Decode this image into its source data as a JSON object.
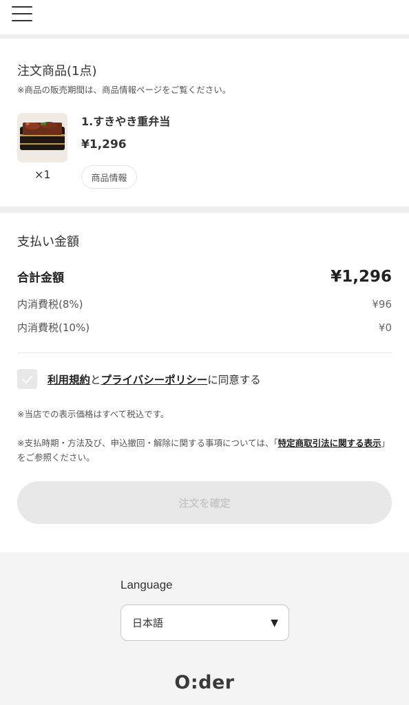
{
  "header": {
    "menu_icon": "hamburger-menu-icon"
  },
  "order": {
    "title": "注文商品(1点)",
    "note": "※商品の販売期間は、商品情報ページをご覧ください。",
    "item": {
      "name": "1.すきやき重弁当",
      "price": "¥1,296",
      "quantity": "×1",
      "info_button": "商品情報"
    }
  },
  "payment": {
    "title": "支払い金額",
    "total_label": "合計金額",
    "total_value": "¥1,296",
    "tax8_label": "内消費税(8%)",
    "tax8_value": "¥96",
    "tax10_label": "内消費税(10%)",
    "tax10_value": "¥0",
    "agree": {
      "terms_link": "利用規約",
      "and": "と",
      "privacy_link": "プライバシーポリシー",
      "suffix": "に同意する",
      "checked": false
    },
    "note_tax_included": "※当店での表示価格はすべて税込です。",
    "note_law_prefix": "※支払時期・方法及び、申込撤回・解除に関する事項については、「",
    "note_law_link": "特定商取引法に関する表示",
    "note_law_suffix": "」をご参照ください。",
    "confirm_button": "注文を確定"
  },
  "footer": {
    "language_label": "Language",
    "language_value": "日本語",
    "logo": "O:der"
  },
  "colors": {
    "separator": "#eeeeee",
    "footer_bg": "#f4f4f4",
    "disabled_button_bg": "#e8e8e8",
    "disabled_button_text": "#c8c8c8"
  }
}
